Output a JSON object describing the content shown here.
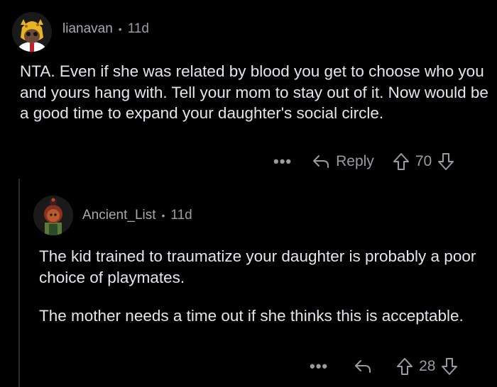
{
  "comments": [
    {
      "username": "lianavan",
      "age": "11d",
      "paragraphs": [
        "NTA. Even if she was related by blood you get to choose who you and yours hang with. Tell your mom to stay out of it. Now would be a good time to expand your daughter's social circle."
      ],
      "more_label": "•••",
      "reply_label": "Reply",
      "score": "70"
    },
    {
      "username": "Ancient_List",
      "age": "11d",
      "paragraphs": [
        "The kid trained to traumatize your daughter is probably a poor choice of playmates.",
        "The mother needs a time out if she thinks this is acceptable."
      ],
      "more_label": "•••",
      "score": "28"
    }
  ],
  "separator": "•"
}
